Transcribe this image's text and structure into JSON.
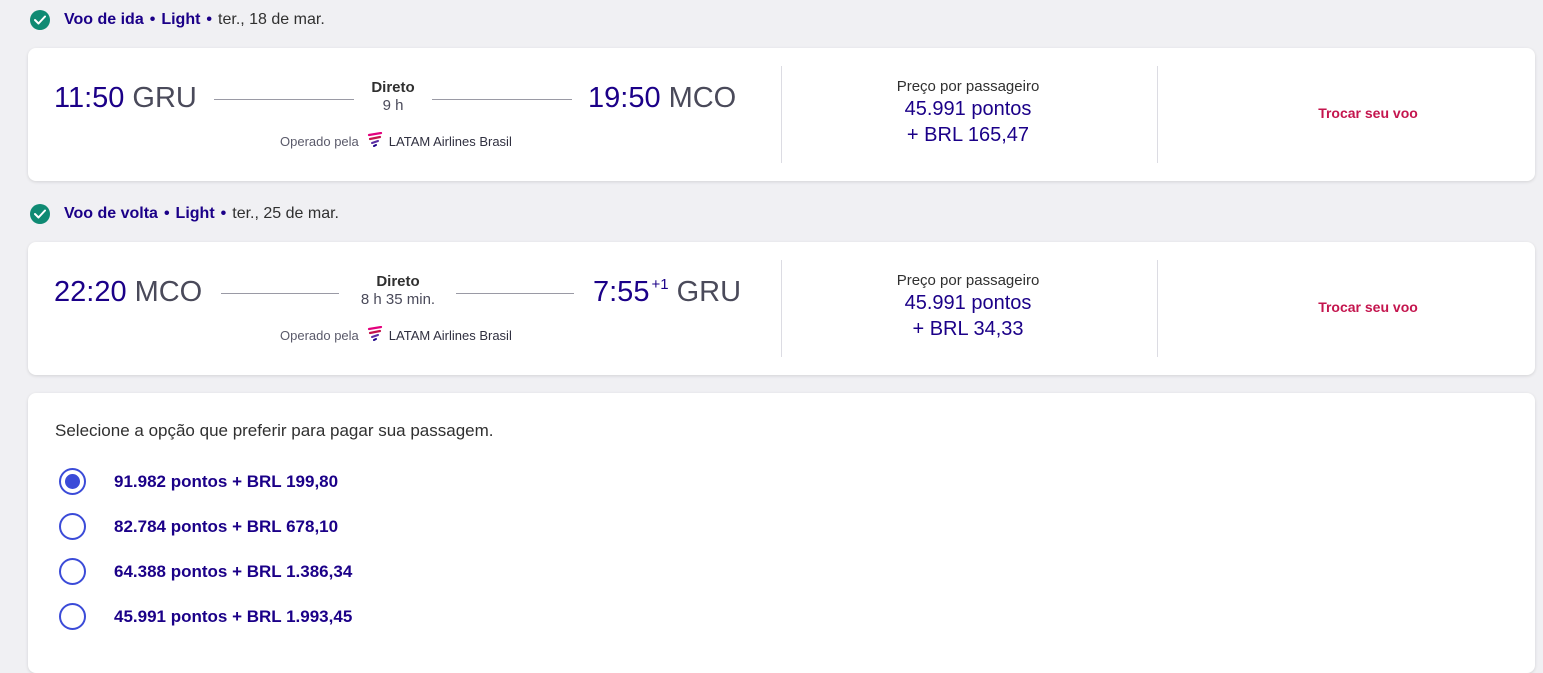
{
  "outbound": {
    "title": "Voo de ida",
    "fare": "Light",
    "date": "ter., 18 de mar.",
    "dep_time": "11:50",
    "dep_airport": "GRU",
    "stop_type": "Direto",
    "duration": "9 h",
    "arr_time": "19:50",
    "arr_superscript": "",
    "arr_airport": "MCO",
    "operated_label": "Operado pela",
    "airline": "LATAM Airlines Brasil",
    "price_label": "Preço por passageiro",
    "price_points": "45.991 pontos",
    "price_money": "+ BRL 165,47",
    "change_label": "Trocar seu voo"
  },
  "return": {
    "title": "Voo de volta",
    "fare": "Light",
    "date": "ter., 25 de mar.",
    "dep_time": "22:20",
    "dep_airport": "MCO",
    "stop_type": "Direto",
    "duration": "8 h 35 min.",
    "arr_time": "7:55",
    "arr_superscript": "+1",
    "arr_airport": "GRU",
    "operated_label": "Operado pela",
    "airline": "LATAM Airlines Brasil",
    "price_label": "Preço por passageiro",
    "price_points": "45.991 pontos",
    "price_money": "+ BRL 34,33",
    "change_label": "Trocar seu voo"
  },
  "payment": {
    "title": "Selecione a opção que preferir para pagar sua passagem.",
    "options": [
      {
        "label": "91.982 pontos + BRL 199,80",
        "selected": true
      },
      {
        "label": "82.784 pontos + BRL 678,10",
        "selected": false
      },
      {
        "label": "64.388 pontos + BRL 1.386,34",
        "selected": false
      },
      {
        "label": "45.991 pontos + BRL 1.993,45",
        "selected": false
      }
    ]
  },
  "colors": {
    "brand_navy": "#1b0088",
    "accent_crimson": "#c4154e",
    "check_green": "#0f8a73",
    "radio_blue": "#3b4bd8"
  },
  "icons": {
    "section_check": "check-circle-icon",
    "airline_logo": "latam-logo-icon",
    "radio": "radio-button-icon"
  }
}
